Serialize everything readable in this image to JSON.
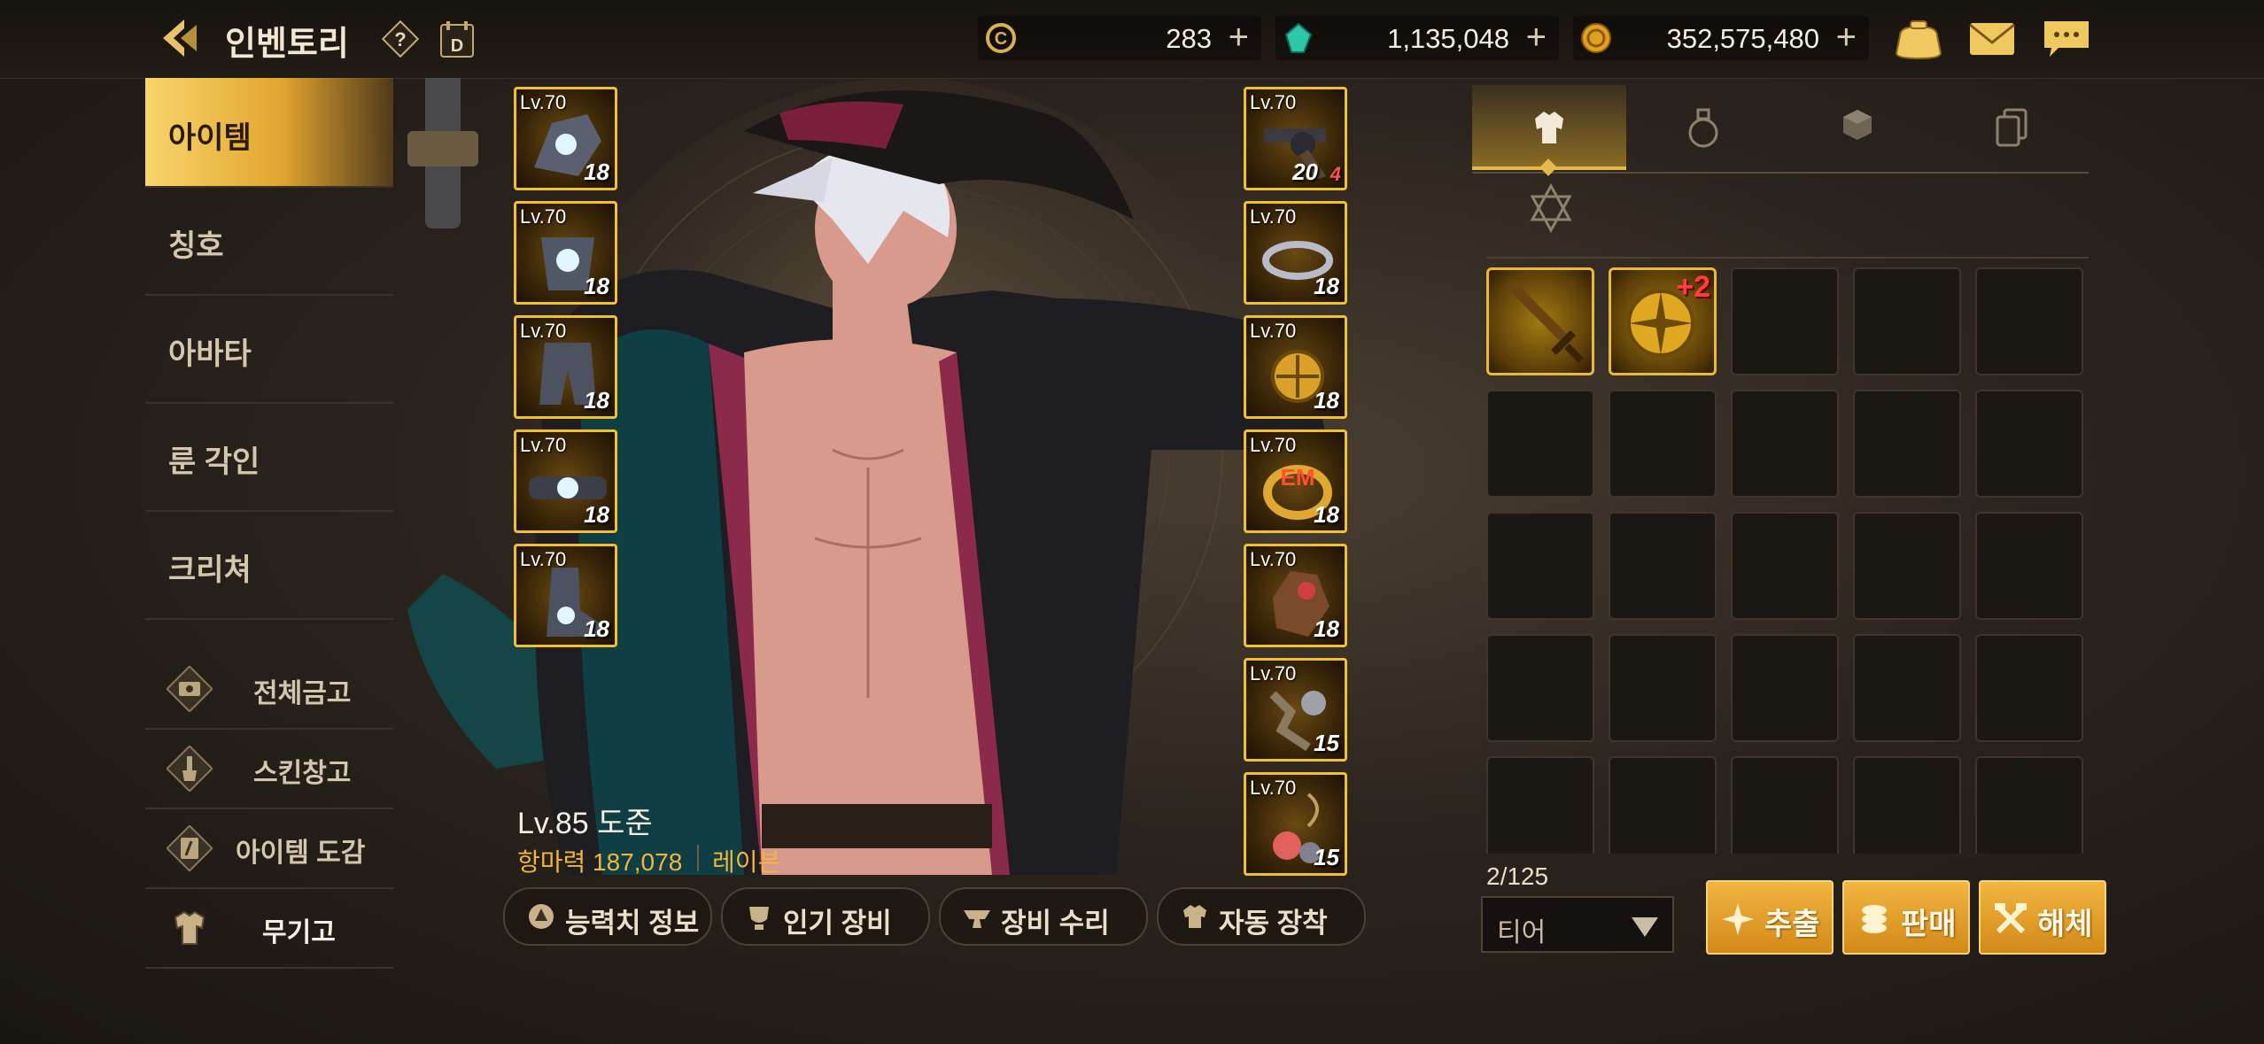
{
  "header": {
    "title": "인벤토리",
    "currencies": [
      {
        "name": "coin-c",
        "value": "283"
      },
      {
        "name": "crystal",
        "value": "1,135,048"
      },
      {
        "name": "gold",
        "value": "352,575,480"
      }
    ],
    "plus": "+"
  },
  "menu": {
    "items": [
      {
        "label": "아이템",
        "active": true
      },
      {
        "label": "칭호"
      },
      {
        "label": "아바타"
      },
      {
        "label": "룬 각인"
      },
      {
        "label": "크리쳐"
      }
    ],
    "sub_items": [
      {
        "label": "전체금고",
        "icon": "vault-icon"
      },
      {
        "label": "스킨창고",
        "icon": "brush-icon"
      },
      {
        "label": "아이템 도감",
        "icon": "book-icon"
      },
      {
        "label": "무기고",
        "icon": "armor-icon",
        "active": true
      }
    ]
  },
  "equipment": {
    "left": [
      {
        "level": "Lv.70",
        "enhance": "18"
      },
      {
        "level": "Lv.70",
        "enhance": "18"
      },
      {
        "level": "Lv.70",
        "enhance": "18"
      },
      {
        "level": "Lv.70",
        "enhance": "18"
      },
      {
        "level": "Lv.70",
        "enhance": "18"
      }
    ],
    "right": [
      {
        "level": "Lv.70",
        "enhance": "20",
        "extra": "4"
      },
      {
        "level": "Lv.70",
        "enhance": "18"
      },
      {
        "level": "Lv.70",
        "enhance": "18"
      },
      {
        "level": "Lv.70",
        "enhance": "18"
      },
      {
        "level": "Lv.70",
        "enhance": "18"
      },
      {
        "level": "Lv.70",
        "enhance": "15"
      },
      {
        "level": "Lv.70",
        "enhance": "15"
      }
    ]
  },
  "character": {
    "name": "Lv.85 도준",
    "power": "항마력 187,078",
    "class": "레이븐"
  },
  "actions": {
    "stats": "능력치 정보",
    "popular": "인기 장비",
    "repair": "장비 수리",
    "auto_equip": "자동 장착"
  },
  "inventory": {
    "tabs": [
      "equipment-tab",
      "potion-tab",
      "material-tab",
      "card-tab"
    ],
    "sub_tab": "emblem-tab",
    "badge": "+2",
    "count": "2/125",
    "sort": "티어",
    "buttons": {
      "extract": "추출",
      "sell": "판매",
      "disassemble": "해체"
    }
  },
  "colors": {
    "accent": "#f0c030",
    "button": "#e3a028",
    "power_text": "#f3b53a"
  }
}
